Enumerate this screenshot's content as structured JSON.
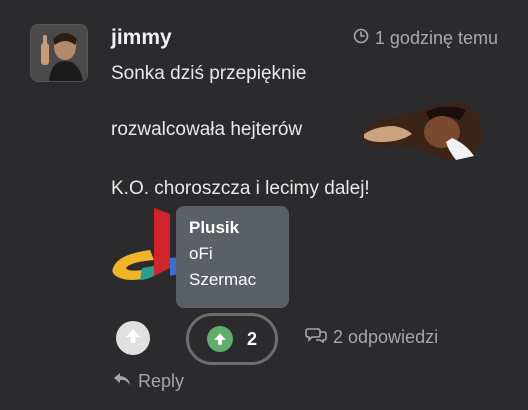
{
  "post": {
    "author": "jimmy",
    "time_ago": "1 godzinę temu",
    "lines": [
      "Sonka dziś przepięknie",
      "rozwalcowała hejterów",
      "K.O. choroszcza i lecimy dalej!"
    ]
  },
  "tooltip": {
    "names": [
      "Plusik",
      "oFi",
      "Szermac"
    ]
  },
  "votes": {
    "count": "2"
  },
  "actions": {
    "replies_label": "2 odpowiedzi",
    "reply_label": "Reply"
  },
  "icons": {
    "time": "clock-icon",
    "upvote": "arrow-up-icon",
    "replies": "speech-bubbles-icon",
    "reply": "reply-arrow-icon"
  },
  "colors": {
    "background": "#2b2b2d",
    "tooltip": "#5b5f66",
    "upvote_active": "#5fae6b"
  }
}
